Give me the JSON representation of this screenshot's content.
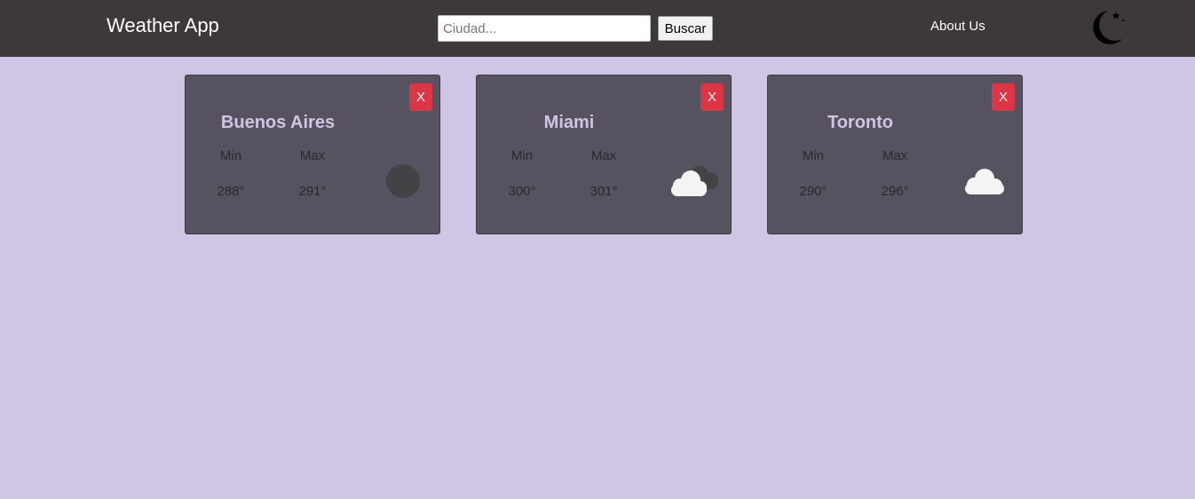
{
  "navbar": {
    "brand": "Weather App",
    "search_placeholder": "Ciudad...",
    "search_value": "",
    "search_button": "Buscar",
    "about_link": "About Us",
    "theme_toggle_icon": "moon-stars-icon"
  },
  "labels": {
    "min": "Min",
    "max": "Max",
    "close": "X"
  },
  "cards": [
    {
      "city": "Buenos Aires",
      "min": "288°",
      "max": "291°",
      "icon": "clear-night-icon"
    },
    {
      "city": "Miami",
      "min": "300°",
      "max": "301°",
      "icon": "broken-clouds-icon"
    },
    {
      "city": "Toronto",
      "min": "290°",
      "max": "296°",
      "icon": "few-clouds-icon"
    }
  ],
  "colors": {
    "navbar": "#3d3938",
    "background": "#cfc5e5",
    "card": "#57525f",
    "close_button": "#dc3545"
  }
}
